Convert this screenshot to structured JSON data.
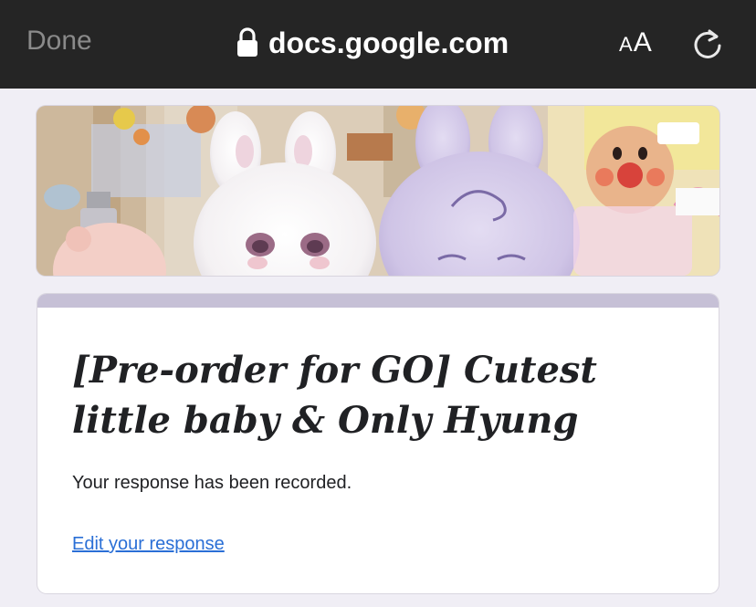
{
  "browser": {
    "done_label": "Done",
    "url": "docs.google.com",
    "text_size_small": "A",
    "text_size_large": "A",
    "icons": {
      "lock": "lock-icon",
      "reload": "reload-icon"
    }
  },
  "form": {
    "banner_image": "header-photo",
    "title": "[Pre-order for GO] Cutest little baby & Only Hyung",
    "confirmation_message": "Your response has been recorded.",
    "edit_link_label": "Edit your response"
  },
  "colors": {
    "toolbar_bg": "#252525",
    "page_bg": "#f0eef5",
    "card_accent": "#c6c0d6",
    "link": "#2a6fd6"
  }
}
